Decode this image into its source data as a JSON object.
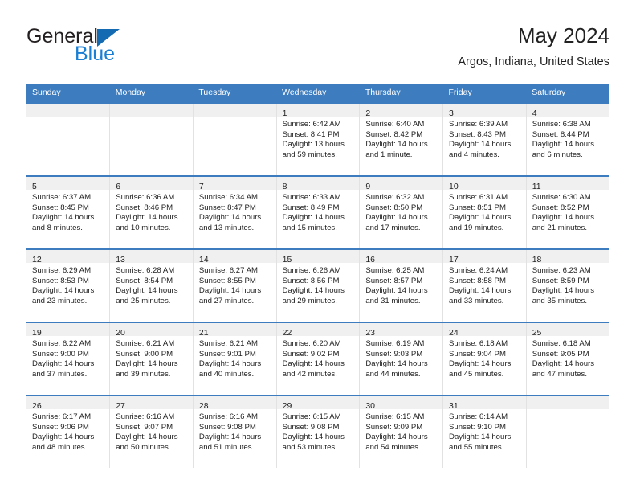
{
  "logo": {
    "word1": "General",
    "word2": "Blue",
    "triangle_color": "#156bb1",
    "word2_color": "#1b7fd4"
  },
  "header": {
    "title": "May 2024",
    "subtitle": "Argos, Indiana, United States"
  },
  "theme": {
    "header_blue": "#3c7cbf",
    "daynum_band": "#f0f0f0",
    "grid_line": "#e2e2e2"
  },
  "weekdays": [
    "Sunday",
    "Monday",
    "Tuesday",
    "Wednesday",
    "Thursday",
    "Friday",
    "Saturday"
  ],
  "labels": {
    "sunrise_prefix": "Sunrise:",
    "sunset_prefix": "Sunset:",
    "daylight_prefix": "Daylight:"
  },
  "weeks": [
    [
      {
        "day": "",
        "empty": true
      },
      {
        "day": "",
        "empty": true
      },
      {
        "day": "",
        "empty": true
      },
      {
        "day": "1",
        "sunrise": "Sunrise: 6:42 AM",
        "sunset": "Sunset: 8:41 PM",
        "daylight1": "Daylight: 13 hours",
        "daylight2": "and 59 minutes."
      },
      {
        "day": "2",
        "sunrise": "Sunrise: 6:40 AM",
        "sunset": "Sunset: 8:42 PM",
        "daylight1": "Daylight: 14 hours",
        "daylight2": "and 1 minute."
      },
      {
        "day": "3",
        "sunrise": "Sunrise: 6:39 AM",
        "sunset": "Sunset: 8:43 PM",
        "daylight1": "Daylight: 14 hours",
        "daylight2": "and 4 minutes."
      },
      {
        "day": "4",
        "sunrise": "Sunrise: 6:38 AM",
        "sunset": "Sunset: 8:44 PM",
        "daylight1": "Daylight: 14 hours",
        "daylight2": "and 6 minutes."
      }
    ],
    [
      {
        "day": "5",
        "sunrise": "Sunrise: 6:37 AM",
        "sunset": "Sunset: 8:45 PM",
        "daylight1": "Daylight: 14 hours",
        "daylight2": "and 8 minutes."
      },
      {
        "day": "6",
        "sunrise": "Sunrise: 6:36 AM",
        "sunset": "Sunset: 8:46 PM",
        "daylight1": "Daylight: 14 hours",
        "daylight2": "and 10 minutes."
      },
      {
        "day": "7",
        "sunrise": "Sunrise: 6:34 AM",
        "sunset": "Sunset: 8:47 PM",
        "daylight1": "Daylight: 14 hours",
        "daylight2": "and 13 minutes."
      },
      {
        "day": "8",
        "sunrise": "Sunrise: 6:33 AM",
        "sunset": "Sunset: 8:49 PM",
        "daylight1": "Daylight: 14 hours",
        "daylight2": "and 15 minutes."
      },
      {
        "day": "9",
        "sunrise": "Sunrise: 6:32 AM",
        "sunset": "Sunset: 8:50 PM",
        "daylight1": "Daylight: 14 hours",
        "daylight2": "and 17 minutes."
      },
      {
        "day": "10",
        "sunrise": "Sunrise: 6:31 AM",
        "sunset": "Sunset: 8:51 PM",
        "daylight1": "Daylight: 14 hours",
        "daylight2": "and 19 minutes."
      },
      {
        "day": "11",
        "sunrise": "Sunrise: 6:30 AM",
        "sunset": "Sunset: 8:52 PM",
        "daylight1": "Daylight: 14 hours",
        "daylight2": "and 21 minutes."
      }
    ],
    [
      {
        "day": "12",
        "sunrise": "Sunrise: 6:29 AM",
        "sunset": "Sunset: 8:53 PM",
        "daylight1": "Daylight: 14 hours",
        "daylight2": "and 23 minutes."
      },
      {
        "day": "13",
        "sunrise": "Sunrise: 6:28 AM",
        "sunset": "Sunset: 8:54 PM",
        "daylight1": "Daylight: 14 hours",
        "daylight2": "and 25 minutes."
      },
      {
        "day": "14",
        "sunrise": "Sunrise: 6:27 AM",
        "sunset": "Sunset: 8:55 PM",
        "daylight1": "Daylight: 14 hours",
        "daylight2": "and 27 minutes."
      },
      {
        "day": "15",
        "sunrise": "Sunrise: 6:26 AM",
        "sunset": "Sunset: 8:56 PM",
        "daylight1": "Daylight: 14 hours",
        "daylight2": "and 29 minutes."
      },
      {
        "day": "16",
        "sunrise": "Sunrise: 6:25 AM",
        "sunset": "Sunset: 8:57 PM",
        "daylight1": "Daylight: 14 hours",
        "daylight2": "and 31 minutes."
      },
      {
        "day": "17",
        "sunrise": "Sunrise: 6:24 AM",
        "sunset": "Sunset: 8:58 PM",
        "daylight1": "Daylight: 14 hours",
        "daylight2": "and 33 minutes."
      },
      {
        "day": "18",
        "sunrise": "Sunrise: 6:23 AM",
        "sunset": "Sunset: 8:59 PM",
        "daylight1": "Daylight: 14 hours",
        "daylight2": "and 35 minutes."
      }
    ],
    [
      {
        "day": "19",
        "sunrise": "Sunrise: 6:22 AM",
        "sunset": "Sunset: 9:00 PM",
        "daylight1": "Daylight: 14 hours",
        "daylight2": "and 37 minutes."
      },
      {
        "day": "20",
        "sunrise": "Sunrise: 6:21 AM",
        "sunset": "Sunset: 9:00 PM",
        "daylight1": "Daylight: 14 hours",
        "daylight2": "and 39 minutes."
      },
      {
        "day": "21",
        "sunrise": "Sunrise: 6:21 AM",
        "sunset": "Sunset: 9:01 PM",
        "daylight1": "Daylight: 14 hours",
        "daylight2": "and 40 minutes."
      },
      {
        "day": "22",
        "sunrise": "Sunrise: 6:20 AM",
        "sunset": "Sunset: 9:02 PM",
        "daylight1": "Daylight: 14 hours",
        "daylight2": "and 42 minutes."
      },
      {
        "day": "23",
        "sunrise": "Sunrise: 6:19 AM",
        "sunset": "Sunset: 9:03 PM",
        "daylight1": "Daylight: 14 hours",
        "daylight2": "and 44 minutes."
      },
      {
        "day": "24",
        "sunrise": "Sunrise: 6:18 AM",
        "sunset": "Sunset: 9:04 PM",
        "daylight1": "Daylight: 14 hours",
        "daylight2": "and 45 minutes."
      },
      {
        "day": "25",
        "sunrise": "Sunrise: 6:18 AM",
        "sunset": "Sunset: 9:05 PM",
        "daylight1": "Daylight: 14 hours",
        "daylight2": "and 47 minutes."
      }
    ],
    [
      {
        "day": "26",
        "sunrise": "Sunrise: 6:17 AM",
        "sunset": "Sunset: 9:06 PM",
        "daylight1": "Daylight: 14 hours",
        "daylight2": "and 48 minutes."
      },
      {
        "day": "27",
        "sunrise": "Sunrise: 6:16 AM",
        "sunset": "Sunset: 9:07 PM",
        "daylight1": "Daylight: 14 hours",
        "daylight2": "and 50 minutes."
      },
      {
        "day": "28",
        "sunrise": "Sunrise: 6:16 AM",
        "sunset": "Sunset: 9:08 PM",
        "daylight1": "Daylight: 14 hours",
        "daylight2": "and 51 minutes."
      },
      {
        "day": "29",
        "sunrise": "Sunrise: 6:15 AM",
        "sunset": "Sunset: 9:08 PM",
        "daylight1": "Daylight: 14 hours",
        "daylight2": "and 53 minutes."
      },
      {
        "day": "30",
        "sunrise": "Sunrise: 6:15 AM",
        "sunset": "Sunset: 9:09 PM",
        "daylight1": "Daylight: 14 hours",
        "daylight2": "and 54 minutes."
      },
      {
        "day": "31",
        "sunrise": "Sunrise: 6:14 AM",
        "sunset": "Sunset: 9:10 PM",
        "daylight1": "Daylight: 14 hours",
        "daylight2": "and 55 minutes."
      },
      {
        "day": "",
        "empty": true
      }
    ]
  ]
}
